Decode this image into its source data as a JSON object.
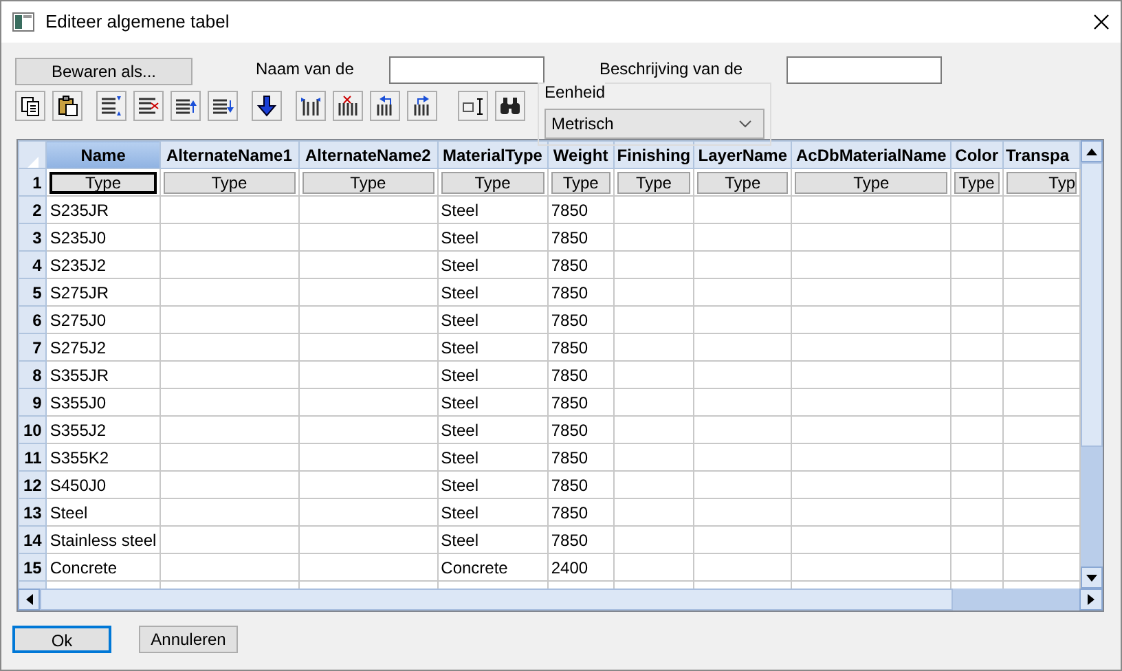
{
  "window": {
    "title": "Editeer algemene tabel"
  },
  "save_as_button": "Bewaren als...",
  "name_field": {
    "label": "Naam van de"
  },
  "description_field": {
    "label": "Beschrijving van de"
  },
  "unit": {
    "legend": "Eenheid",
    "value": "Metrisch"
  },
  "table": {
    "columns": [
      {
        "label": "Name",
        "selected": true
      },
      {
        "label": "AlternateName1",
        "selected": false
      },
      {
        "label": "AlternateName2",
        "selected": false
      },
      {
        "label": "MaterialType",
        "selected": false
      },
      {
        "label": "Weight",
        "selected": false
      },
      {
        "label": "Finishing",
        "selected": false
      },
      {
        "label": "LayerName",
        "selected": false
      },
      {
        "label": "AcDbMaterialName",
        "selected": false
      },
      {
        "label": "Color",
        "selected": false
      },
      {
        "label": "Transpa",
        "selected": false
      }
    ],
    "type_row": {
      "number": "1",
      "cells": [
        {
          "label": "Type",
          "selected": true
        },
        {
          "label": "Type",
          "selected": false
        },
        {
          "label": "Type",
          "selected": false
        },
        {
          "label": "Type",
          "selected": false
        },
        {
          "label": "Type",
          "selected": false
        },
        {
          "label": "Type",
          "selected": false
        },
        {
          "label": "Type",
          "selected": false
        },
        {
          "label": "Type",
          "selected": false
        },
        {
          "label": "Type",
          "selected": false
        },
        {
          "label": "Typ",
          "selected": false
        }
      ]
    },
    "rows": [
      {
        "number": "2",
        "name": "S235JR",
        "material_type": "Steel",
        "weight": "7850"
      },
      {
        "number": "3",
        "name": "S235J0",
        "material_type": "Steel",
        "weight": "7850"
      },
      {
        "number": "4",
        "name": "S235J2",
        "material_type": "Steel",
        "weight": "7850"
      },
      {
        "number": "5",
        "name": "S275JR",
        "material_type": "Steel",
        "weight": "7850"
      },
      {
        "number": "6",
        "name": "S275J0",
        "material_type": "Steel",
        "weight": "7850"
      },
      {
        "number": "7",
        "name": "S275J2",
        "material_type": "Steel",
        "weight": "7850"
      },
      {
        "number": "8",
        "name": "S355JR",
        "material_type": "Steel",
        "weight": "7850"
      },
      {
        "number": "9",
        "name": "S355J0",
        "material_type": "Steel",
        "weight": "7850"
      },
      {
        "number": "10",
        "name": "S355J2",
        "material_type": "Steel",
        "weight": "7850"
      },
      {
        "number": "11",
        "name": "S355K2",
        "material_type": "Steel",
        "weight": "7850"
      },
      {
        "number": "12",
        "name": "S450J0",
        "material_type": "Steel",
        "weight": "7850"
      },
      {
        "number": "13",
        "name": "Steel",
        "material_type": "Steel",
        "weight": "7850"
      },
      {
        "number": "14",
        "name": "Stainless steel",
        "material_type": "Steel",
        "weight": "7850"
      },
      {
        "number": "15",
        "name": "Concrete",
        "material_type": "Concrete",
        "weight": "2400"
      }
    ]
  },
  "buttons": [
    {
      "label": "Ok",
      "default": true
    },
    {
      "label": "Annuleren",
      "default": false
    }
  ]
}
